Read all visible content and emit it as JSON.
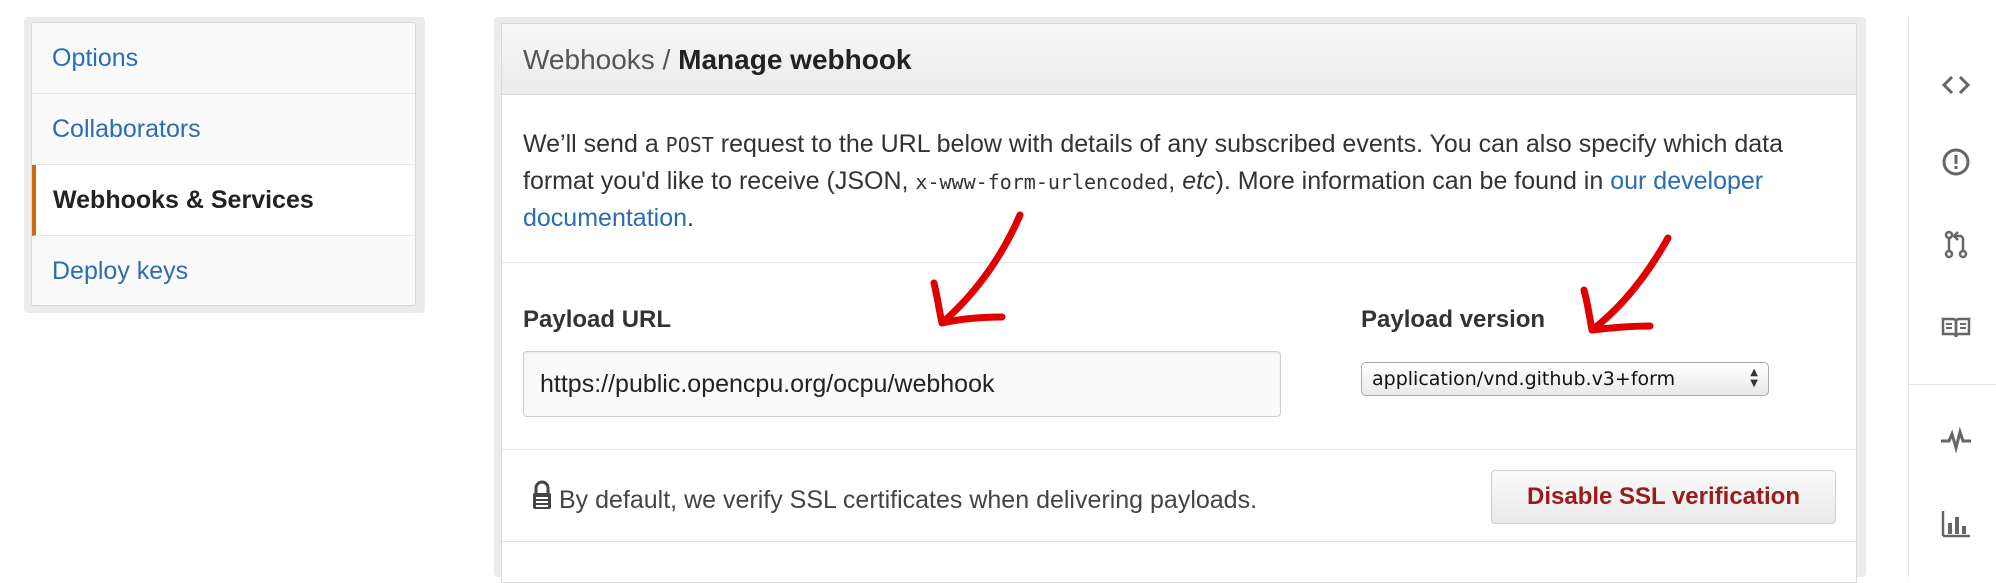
{
  "sidebar": {
    "items": [
      {
        "label": "Options",
        "active": false
      },
      {
        "label": "Collaborators",
        "active": false
      },
      {
        "label": "Webhooks & Services",
        "active": true
      },
      {
        "label": "Deploy keys",
        "active": false
      }
    ]
  },
  "panel": {
    "breadcrumb_parent": "Webhooks",
    "breadcrumb_sep": " / ",
    "title": "Manage webhook",
    "intro": {
      "t1": "We’ll send a ",
      "post": "POST",
      "t2": " request to the URL below with details of any subscribed events. You can also specify which data format you'd like to receive (JSON, ",
      "form": "x-www-form-urlencoded",
      "t3": ", ",
      "etc": "etc",
      "t4": "). More information can be found in ",
      "link": "our developer documentation",
      "t5": "."
    },
    "payload_url_label": "Payload URL",
    "payload_url_value": "https://public.opencpu.org/ocpu/webhook",
    "payload_version_label": "Payload version",
    "payload_version_selected": "application/vnd.github.v3+form",
    "ssl_text": "By default, we verify SSL certificates when delivering payloads.",
    "ssl_button": "Disable SSL verification"
  },
  "right_rail": {
    "icons": [
      "code-icon",
      "issue-icon",
      "pull-request-icon",
      "wiki-icon",
      "pulse-icon",
      "graphs-icon"
    ]
  },
  "colors": {
    "link": "#2a6db4",
    "active_accent": "#d26911",
    "danger_text": "#9b1b1b",
    "annotation": "#e00000"
  }
}
